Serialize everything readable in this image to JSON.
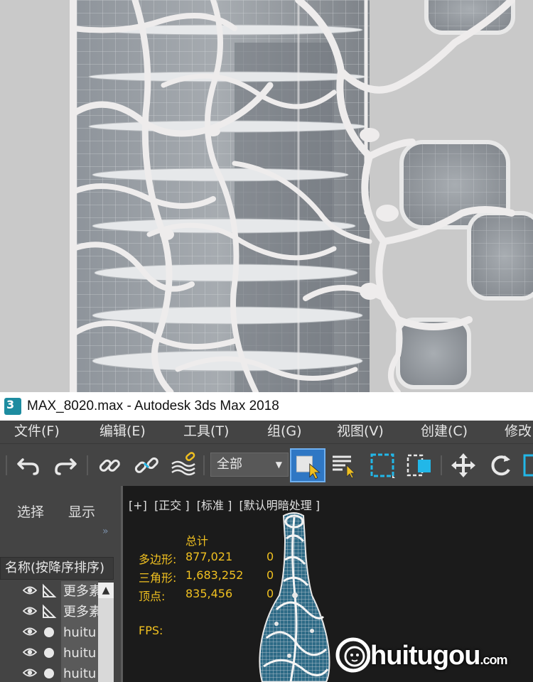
{
  "window": {
    "title": "MAX_8020.max - Autodesk 3ds Max 2018",
    "logo": "3"
  },
  "menubar": {
    "items": [
      "文件(F)",
      "编辑(E)",
      "工具(T)",
      "组(G)",
      "视图(V)",
      "创建(C)",
      "修改"
    ]
  },
  "toolbar": {
    "selection_filter": "全部",
    "icons": [
      "undo-icon",
      "redo-icon",
      "link-icon",
      "unlink-icon",
      "bind-spacewarp-icon",
      "select-object-icon",
      "select-by-name-icon",
      "rect-selection-region-icon",
      "window-crossing-icon",
      "move-icon",
      "rotate-icon",
      "scale-icon"
    ]
  },
  "scene_explorer": {
    "tabs": [
      "选择",
      "显示"
    ],
    "expand": "»",
    "column_header": "名称(按降序排序)",
    "rows": [
      {
        "label": "更多素",
        "type": "camera"
      },
      {
        "label": "更多素",
        "type": "camera"
      },
      {
        "label": "huitu",
        "type": "sphere"
      },
      {
        "label": "huitu",
        "type": "sphere"
      },
      {
        "label": "huitu",
        "type": "sphere"
      }
    ]
  },
  "viewport": {
    "label": "[+]  [正交 ]  [标准 ]  [默认明暗处理 ]",
    "stats": {
      "total_header": "总计",
      "rows": [
        {
          "label": "多边形:",
          "value": "877,021",
          "selected": "0"
        },
        {
          "label": "三角形:",
          "value": "1,683,252",
          "selected": "0"
        },
        {
          "label": "顶点:",
          "value": "835,456",
          "selected": "0"
        }
      ],
      "fps_label": "FPS:"
    }
  },
  "watermark": {
    "text": "huitugou",
    "domain": ".com"
  },
  "colors": {
    "ui_dark": "#444444",
    "viewport_bg": "#1b1b1b",
    "stats_yellow": "#f0c020",
    "accent_blue": "#2f77c4",
    "highlight_cyan": "#22b7e8"
  }
}
